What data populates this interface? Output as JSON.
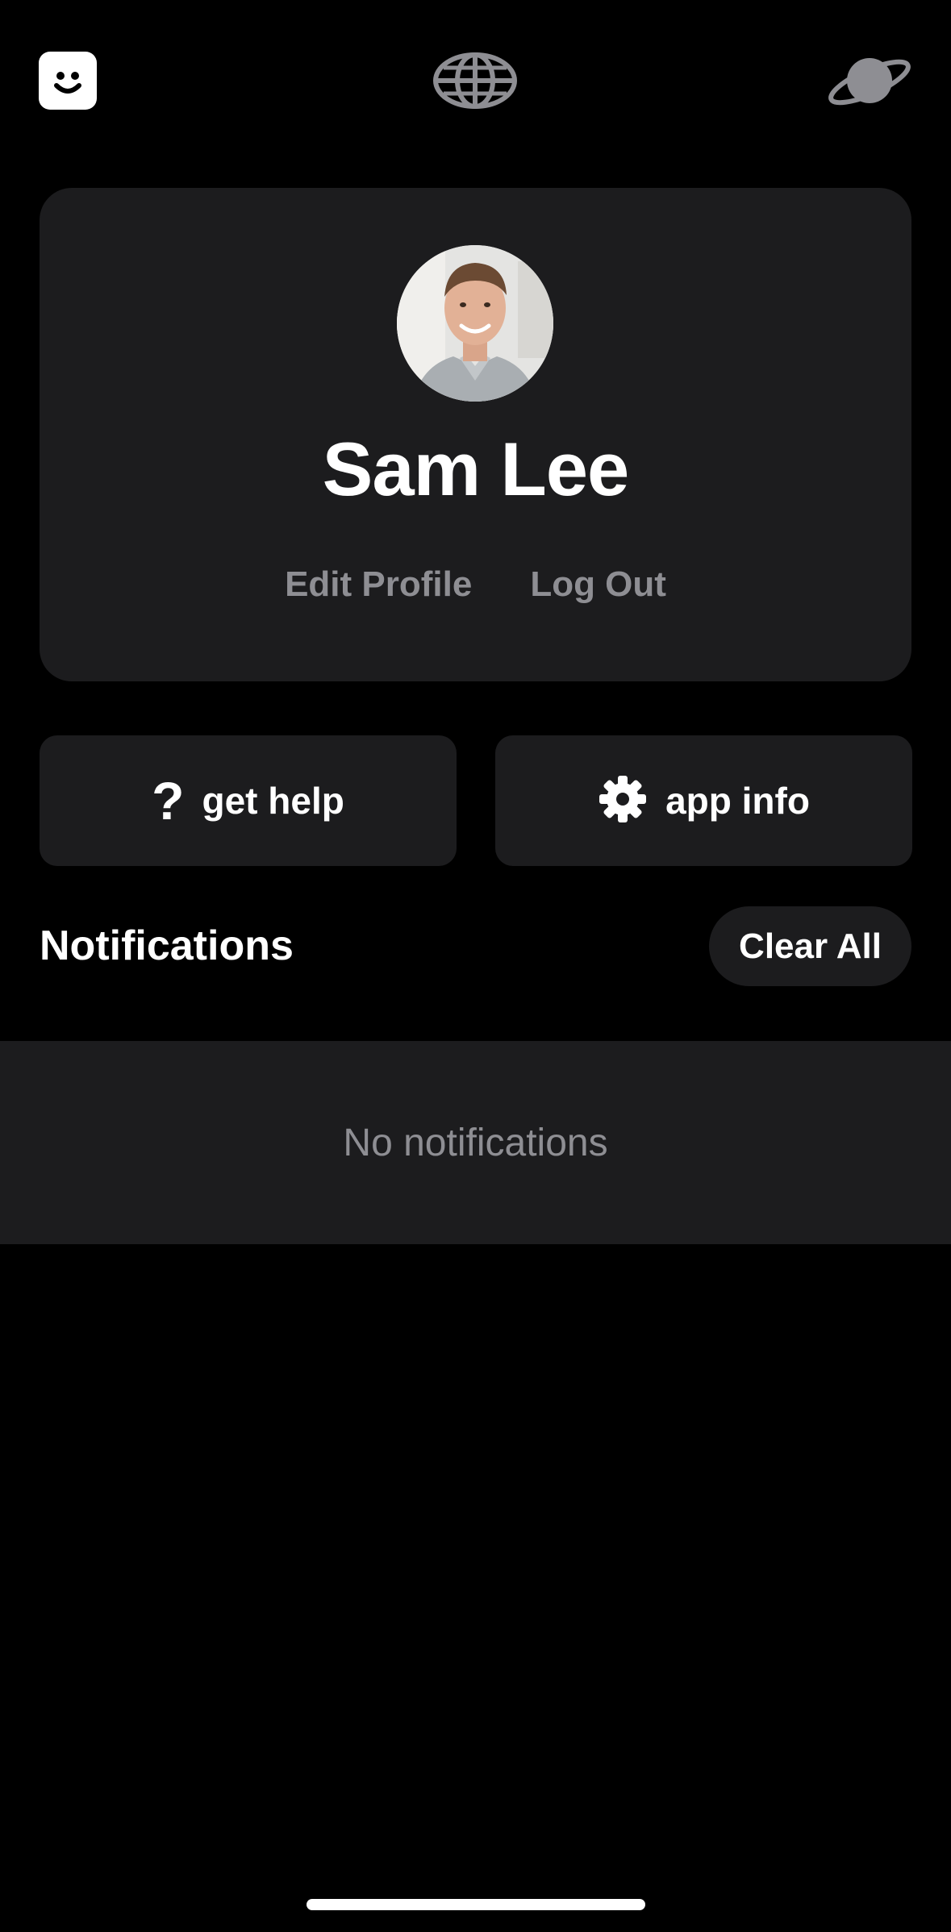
{
  "profile": {
    "name": "Sam Lee",
    "edit_label": "Edit Profile",
    "logout_label": "Log Out"
  },
  "actions": {
    "help_label": "get help",
    "info_label": "app info"
  },
  "notifications": {
    "title": "Notifications",
    "clear_label": "Clear All",
    "empty_text": "No notifications"
  },
  "icons": {
    "left": "smiley-face-icon",
    "center": "globe-icon",
    "right": "planet-icon",
    "help": "question-mark-icon",
    "info": "gear-icon"
  },
  "colors": {
    "background": "#000000",
    "card": "#1c1c1e",
    "muted_text": "#8e8e93",
    "text": "#ffffff"
  }
}
